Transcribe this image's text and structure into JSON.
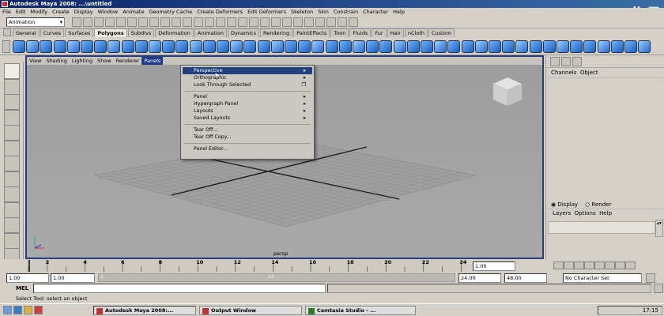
{
  "window": {
    "title": "Autodesk Maya 2008: ...\\untitled",
    "watermark": "作品"
  },
  "menubar": [
    "File",
    "Edit",
    "Modify",
    "Create",
    "Display",
    "Window",
    "Animate",
    "Geometry Cache",
    "Create Deformers",
    "Edit Deformers",
    "Skeleton",
    "Skin",
    "Constrain",
    "Character",
    "Help"
  ],
  "statusline": {
    "mode": "Animation"
  },
  "shelf": {
    "tabs": [
      "General",
      "Curves",
      "Surfaces",
      "Polygons",
      "Subdivs",
      "Deformation",
      "Animation",
      "Dynamics",
      "Rendering",
      "PaintEffects",
      "Toon",
      "Fluids",
      "Fur",
      "Hair",
      "nCloth",
      "Custom"
    ],
    "selected": "Polygons"
  },
  "viewport": {
    "menu": [
      "View",
      "Shading",
      "Lighting",
      "Show",
      "Renderer",
      "Panels"
    ],
    "active_menu": "Panels",
    "camera_label": "persp"
  },
  "panels_menu": {
    "items": [
      {
        "label": "Perspective",
        "submenu": true,
        "highlight": true
      },
      {
        "label": "Orthographic",
        "submenu": true
      },
      {
        "label": "Look Through Selected",
        "option": true
      },
      {
        "sep": true
      },
      {
        "label": "Panel",
        "submenu": true
      },
      {
        "label": "Hypergraph Panel",
        "submenu": true
      },
      {
        "label": "Layouts",
        "submenu": true
      },
      {
        "label": "Saved Layouts",
        "submenu": true
      },
      {
        "sep": true
      },
      {
        "label": "Tear Off..."
      },
      {
        "label": "Tear Off Copy..."
      },
      {
        "sep": true
      },
      {
        "label": "Panel Editor..."
      }
    ]
  },
  "channelbox": {
    "menu": [
      "Channels",
      "Object"
    ]
  },
  "layer_editor": {
    "radio": [
      "Display",
      "Render"
    ],
    "menu": [
      "Layers",
      "Options",
      "Help"
    ]
  },
  "timeline": {
    "ticks": [
      "2",
      "4",
      "6",
      "8",
      "10",
      "12",
      "14",
      "16",
      "18",
      "20",
      "22",
      "24"
    ],
    "current_frame": "1.00"
  },
  "range": {
    "start": "1.00",
    "start2": "1.00",
    "mid_left": "1",
    "mid_right": "24",
    "end": "24.00",
    "end2": "48.00",
    "character_set": "No Character Set"
  },
  "command": {
    "label": "MEL"
  },
  "helpline": "Select Tool: select an object",
  "taskbar": {
    "tasks": [
      "Autodesk Maya 2008:...",
      "Output Window",
      "Camtasia Studio - ..."
    ],
    "clock": "17:15"
  }
}
